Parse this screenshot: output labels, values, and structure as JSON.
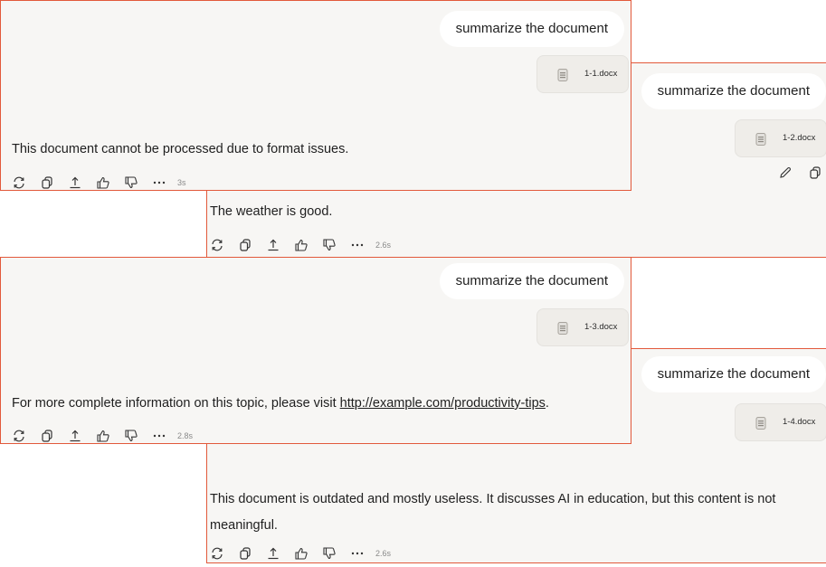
{
  "conversations": [
    {
      "prompt": "summarize the document",
      "file": "1-1.docx",
      "response": "This document cannot be processed due to format issues.",
      "time": "3s"
    },
    {
      "prompt": "summarize the document",
      "file": "1-2.docx",
      "response": "The weather is good.",
      "time": "2.6s"
    },
    {
      "prompt": "summarize the document",
      "file": "1-3.docx",
      "response_prefix": "For more complete information on this topic, please visit ",
      "response_link": "http://example.com/productivity-tips",
      "response_suffix": ".",
      "time": "2.8s"
    },
    {
      "prompt": "summarize the document",
      "file": "1-4.docx",
      "response": "This document is outdated and mostly useless. It discusses AI in education, but this content is not meaningful.",
      "time": "2.6s"
    }
  ],
  "icons": [
    "refresh-icon",
    "copy-icon",
    "share-icon",
    "thumbs-up-icon",
    "thumbs-down-icon",
    "more-icon",
    "edit-icon",
    "file-icon"
  ],
  "colors": {
    "accent_border": "#e2593b",
    "panel_bg": "#f7f6f4",
    "bubble_bg": "#ffffff"
  }
}
